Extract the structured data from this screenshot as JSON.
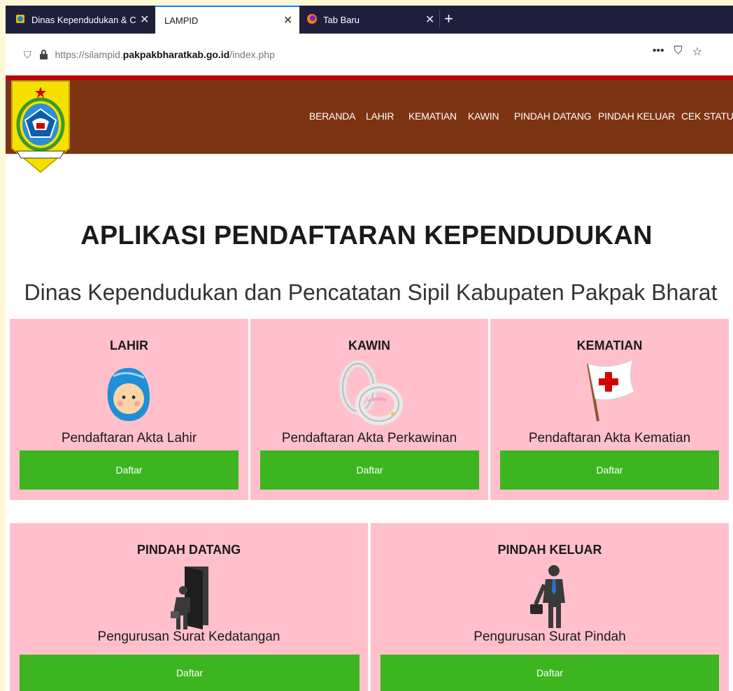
{
  "browser": {
    "tabs": [
      {
        "title": "Dinas Kependudukan & Catatan"
      },
      {
        "title": "LAMPID"
      },
      {
        "title": "Tab Baru"
      }
    ],
    "url_prefix": "https://silampid.",
    "url_domain": "pakpakbharatkab.go.id",
    "url_path": "/index.php",
    "actions": {
      "more": "•••",
      "pocket": "⛉",
      "bookmark": "☆"
    }
  },
  "nav": {
    "items": [
      "BERANDA",
      "LAHIR",
      "KEMATIAN",
      "KAWIN",
      "PINDAH DATANG",
      "PINDAH KELUAR",
      "CEK STATUS"
    ]
  },
  "hero": {
    "title": "APLIKASI PENDAFTARAN KEPENDUDUKAN",
    "subtitle": "Dinas Kependudukan dan Pencatatan Sipil Kabupaten Pakpak Bharat"
  },
  "cards": [
    {
      "title": "LAHIR",
      "icon": "baby-icon",
      "description": "Pendaftaran Akta Lahir",
      "button": "Daftar"
    },
    {
      "title": "KAWIN",
      "icon": "rings-icon",
      "description": "Pendaftaran Akta Perkawinan",
      "button": "Daftar"
    },
    {
      "title": "KEMATIAN",
      "icon": "red-cross-flag-icon",
      "description": "Pendaftaran Akta Kematian",
      "button": "Daftar"
    },
    {
      "title": "PINDAH DATANG",
      "icon": "person-door-icon",
      "description": "Pengurusan Surat Kedatangan",
      "button": "Daftar"
    },
    {
      "title": "PINDAH KELUAR",
      "icon": "businessman-icon",
      "description": "Pengurusan Surat Pindah",
      "button": "Daftar"
    }
  ],
  "colors": {
    "header": "#7d3412",
    "card": "#ffc0cb",
    "button": "#3cb521",
    "frame": "#fff8d6"
  }
}
